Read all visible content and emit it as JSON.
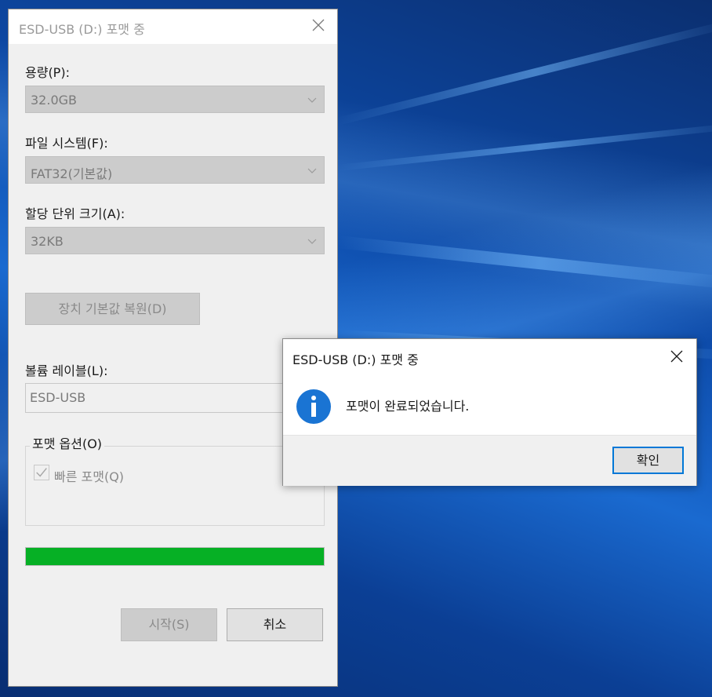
{
  "format_dialog": {
    "title": "ESD-USB (D:) 포맷 중",
    "capacity_label": "용량(P):",
    "capacity_value": "32.0GB",
    "filesystem_label": "파일 시스템(F):",
    "filesystem_value": "FAT32(기본값)",
    "alloc_label": "할당 단위 크기(A):",
    "alloc_value": "32KB",
    "restore_defaults": "장치 기본값 복원(D)",
    "volume_label_label": "볼륨 레이블(L):",
    "volume_label_value": "ESD-USB",
    "options_legend": "포맷 옵션(O)",
    "quick_format_label": "빠른 포맷(Q)",
    "quick_format_checked": true,
    "progress_percent": 100,
    "progress_color": "#06b025",
    "start_button": "시작(S)",
    "cancel_button": "취소"
  },
  "message_box": {
    "title": "ESD-USB (D:) 포맷 중",
    "icon": "info-icon",
    "message": "포맷이 완료되었습니다.",
    "ok_button": "확인",
    "accent_color": "#0078d7"
  }
}
